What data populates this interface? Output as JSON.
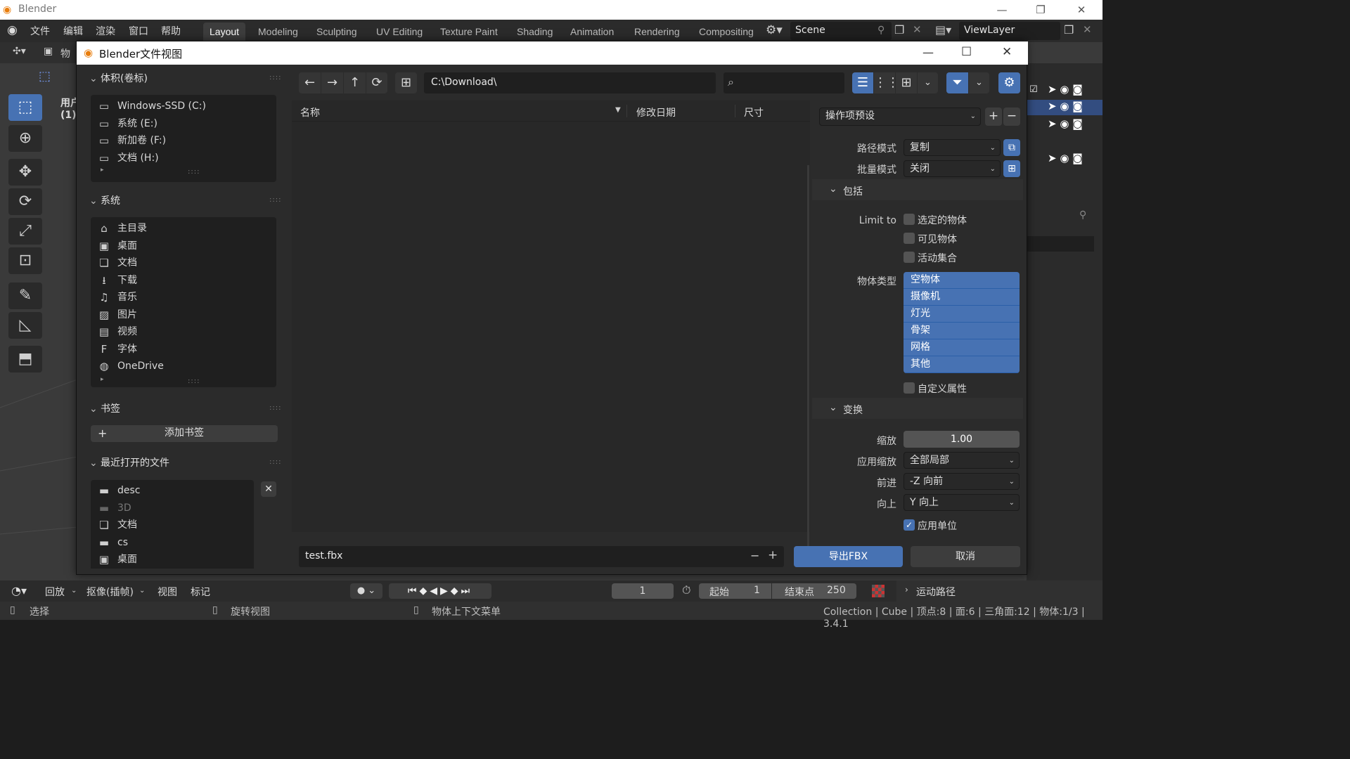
{
  "os": {
    "title": "Blender",
    "minimize": "—",
    "restore": "❐",
    "close": "✕"
  },
  "menubar": {
    "items": [
      "文件",
      "编辑",
      "渲染",
      "窗口",
      "帮助"
    ]
  },
  "workspaces": [
    "Layout",
    "Modeling",
    "Sculpting",
    "UV Editing",
    "Texture Paint",
    "Shading",
    "Animation",
    "Rendering",
    "Compositing"
  ],
  "scene": {
    "name": "Scene"
  },
  "viewlayer": {
    "name": "ViewLayer"
  },
  "viewport": {
    "label_user": "用户",
    "label_count": "(1)",
    "label_obj": "物"
  },
  "dialog": {
    "title": "Blender文件视图",
    "path": "C:\\Download\\",
    "columns": {
      "name": "名称",
      "date": "修改日期",
      "size": "尺寸"
    },
    "filename": "test.fbx",
    "export_label": "导出FBX",
    "cancel_label": "取消"
  },
  "volumes": {
    "header": "体积(卷标)",
    "items": [
      {
        "label": "Windows-SSD (C:)",
        "icon": "drive-icon"
      },
      {
        "label": "系统 (E:)",
        "icon": "drive-icon"
      },
      {
        "label": "新加卷 (F:)",
        "icon": "drive-icon"
      },
      {
        "label": "文档 (H:)",
        "icon": "drive-icon"
      }
    ]
  },
  "system": {
    "header": "系统",
    "items": [
      {
        "label": "主目录",
        "icon": "home-icon",
        "glyph": "⌂"
      },
      {
        "label": "桌面",
        "icon": "desktop-icon",
        "glyph": "▣"
      },
      {
        "label": "文档",
        "icon": "documents-icon",
        "glyph": "❏"
      },
      {
        "label": "下载",
        "icon": "download-icon",
        "glyph": "⭳"
      },
      {
        "label": "音乐",
        "icon": "music-icon",
        "glyph": "♫"
      },
      {
        "label": "图片",
        "icon": "pictures-icon",
        "glyph": "▨"
      },
      {
        "label": "视频",
        "icon": "video-icon",
        "glyph": "▤"
      },
      {
        "label": "字体",
        "icon": "font-icon",
        "glyph": "F"
      },
      {
        "label": "OneDrive",
        "icon": "globe-icon",
        "glyph": "◍"
      }
    ]
  },
  "bookmarks": {
    "header": "书签",
    "add_label": "添加书签"
  },
  "recent": {
    "header": "最近打开的文件",
    "items": [
      {
        "label": "desc",
        "icon": "folder-icon",
        "glyph": "▬",
        "dim": false
      },
      {
        "label": "3D",
        "icon": "folder-icon",
        "glyph": "▬",
        "dim": true
      },
      {
        "label": "文档",
        "icon": "documents-icon",
        "glyph": "❏",
        "dim": false
      },
      {
        "label": "cs",
        "icon": "folder-icon",
        "glyph": "▬",
        "dim": false
      },
      {
        "label": "桌面",
        "icon": "desktop-icon",
        "glyph": "▣",
        "dim": false
      }
    ]
  },
  "props": {
    "preset": "操作项预设",
    "path_mode_label": "路径模式",
    "path_mode_value": "复制",
    "batch_mode_label": "批量模式",
    "batch_mode_value": "关闭",
    "include_header": "包括",
    "limit_to_label": "Limit to",
    "limit_options": [
      "选定的物体",
      "可见物体",
      "活动集合"
    ],
    "object_types_label": "物体类型",
    "object_types": [
      "空物体",
      "摄像机",
      "灯光",
      "骨架",
      "网格",
      "其他"
    ],
    "custom_props_label": "自定义属性",
    "transform_header": "变换",
    "scale_label": "缩放",
    "scale_value": "1.00",
    "apply_scale_label": "应用缩放",
    "apply_scale_value": "全部局部",
    "forward_label": "前进",
    "forward_value": "-Z 向前",
    "up_label": "向上",
    "up_value": "Y 向上",
    "apply_units_label": "应用单位"
  },
  "timeline": {
    "playback": "回放",
    "keying": "抠像(插帧)",
    "view": "视图",
    "marker": "标记",
    "current_frame": "1",
    "start_label": "起始",
    "start_value": "1",
    "end_label": "结束点",
    "end_value": "250",
    "motion_paths": "运动路径"
  },
  "status": {
    "select": "选择",
    "rotate": "旋转视图",
    "context": "物体上下文菜单",
    "info": "Collection | Cube | 顶点:8 | 面:6 | 三角面:12 | 物体:1/3 | 3.4.1"
  },
  "colors": {
    "accent": "#4772b3",
    "panel": "#2b2b2b",
    "field": "#1f1f1f"
  }
}
